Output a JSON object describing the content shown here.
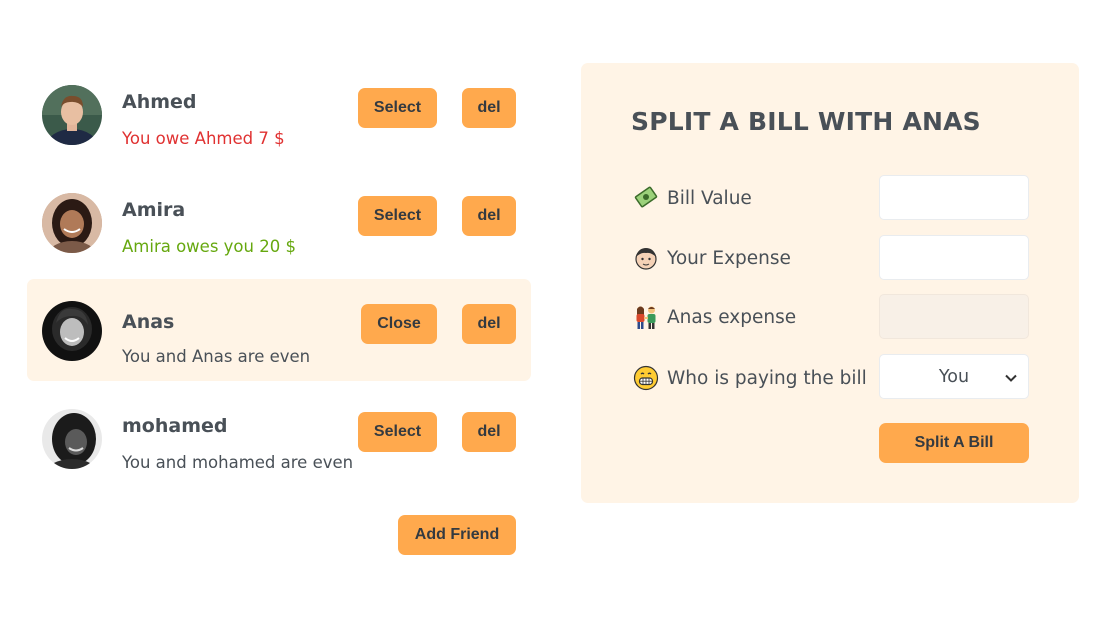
{
  "friends": [
    {
      "name": "Ahmed",
      "status": "You owe Ahmed 7 $",
      "tone": "red",
      "action_label": "Select",
      "delete_label": "del",
      "selected": false
    },
    {
      "name": "Amira",
      "status": "Amira owes you 20 $",
      "tone": "green",
      "action_label": "Select",
      "delete_label": "del",
      "selected": false
    },
    {
      "name": "Anas",
      "status": "You and Anas are even",
      "tone": "neutral",
      "action_label": "Close",
      "delete_label": "del",
      "selected": true
    },
    {
      "name": "mohamed",
      "status": "You and mohamed are even",
      "tone": "neutral",
      "action_label": "Select",
      "delete_label": "del",
      "selected": false
    }
  ],
  "add_friend_label": "Add Friend",
  "split_form": {
    "title": "SPLIT A BILL WITH ANAS",
    "bill_value_label": "Bill Value",
    "bill_value": "",
    "your_expense_label": "Your Expense",
    "your_expense": "",
    "friend_expense_label": "Anas expense",
    "friend_expense": "",
    "payer_label": "Who is paying the bill",
    "payer_selected": "You",
    "submit_label": "Split A Bill"
  },
  "colors": {
    "accent": "#ffa94d",
    "selected_bg": "#fff4e6",
    "owe_red": "#e03131",
    "owed_green": "#66a80f",
    "text": "#495057"
  }
}
